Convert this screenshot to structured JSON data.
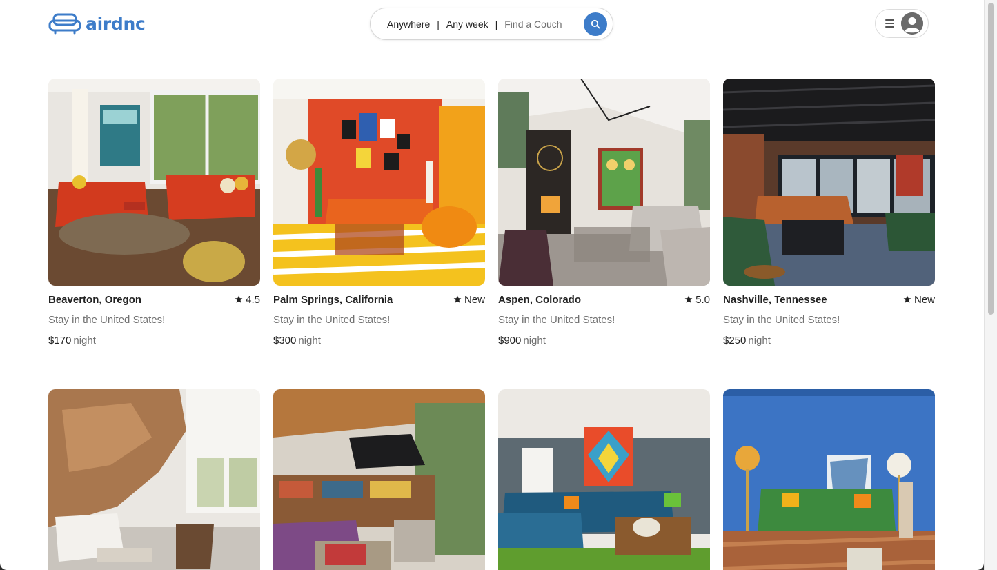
{
  "brand": {
    "name": "airdnc",
    "accent": "#3d7cc9"
  },
  "search": {
    "location": "Anywhere",
    "separator": "|",
    "dates": "Any week",
    "guests_placeholder": "Find a Couch"
  },
  "listings": [
    {
      "location": "Beaverton, Oregon",
      "rating": "4.5",
      "subtitle": "Stay in the United States!",
      "price": "$170",
      "unit": "night"
    },
    {
      "location": "Palm Springs, California",
      "rating": "New",
      "subtitle": "Stay in the United States!",
      "price": "$300",
      "unit": "night"
    },
    {
      "location": "Aspen, Colorado",
      "rating": "5.0",
      "subtitle": "Stay in the United States!",
      "price": "$900",
      "unit": "night"
    },
    {
      "location": "Nashville, Tennessee",
      "rating": "New",
      "subtitle": "Stay in the United States!",
      "price": "$250",
      "unit": "night"
    },
    {
      "location": "",
      "rating": "",
      "subtitle": "",
      "price": "",
      "unit": ""
    },
    {
      "location": "",
      "rating": "",
      "subtitle": "",
      "price": "",
      "unit": ""
    },
    {
      "location": "",
      "rating": "",
      "subtitle": "",
      "price": "",
      "unit": ""
    },
    {
      "location": "",
      "rating": "",
      "subtitle": "",
      "price": "",
      "unit": ""
    }
  ],
  "icons": {
    "logo": "couch-icon",
    "search_button": "search-icon",
    "menu": "hamburger-icon",
    "avatar": "user-avatar-icon",
    "rating": "star-icon"
  }
}
